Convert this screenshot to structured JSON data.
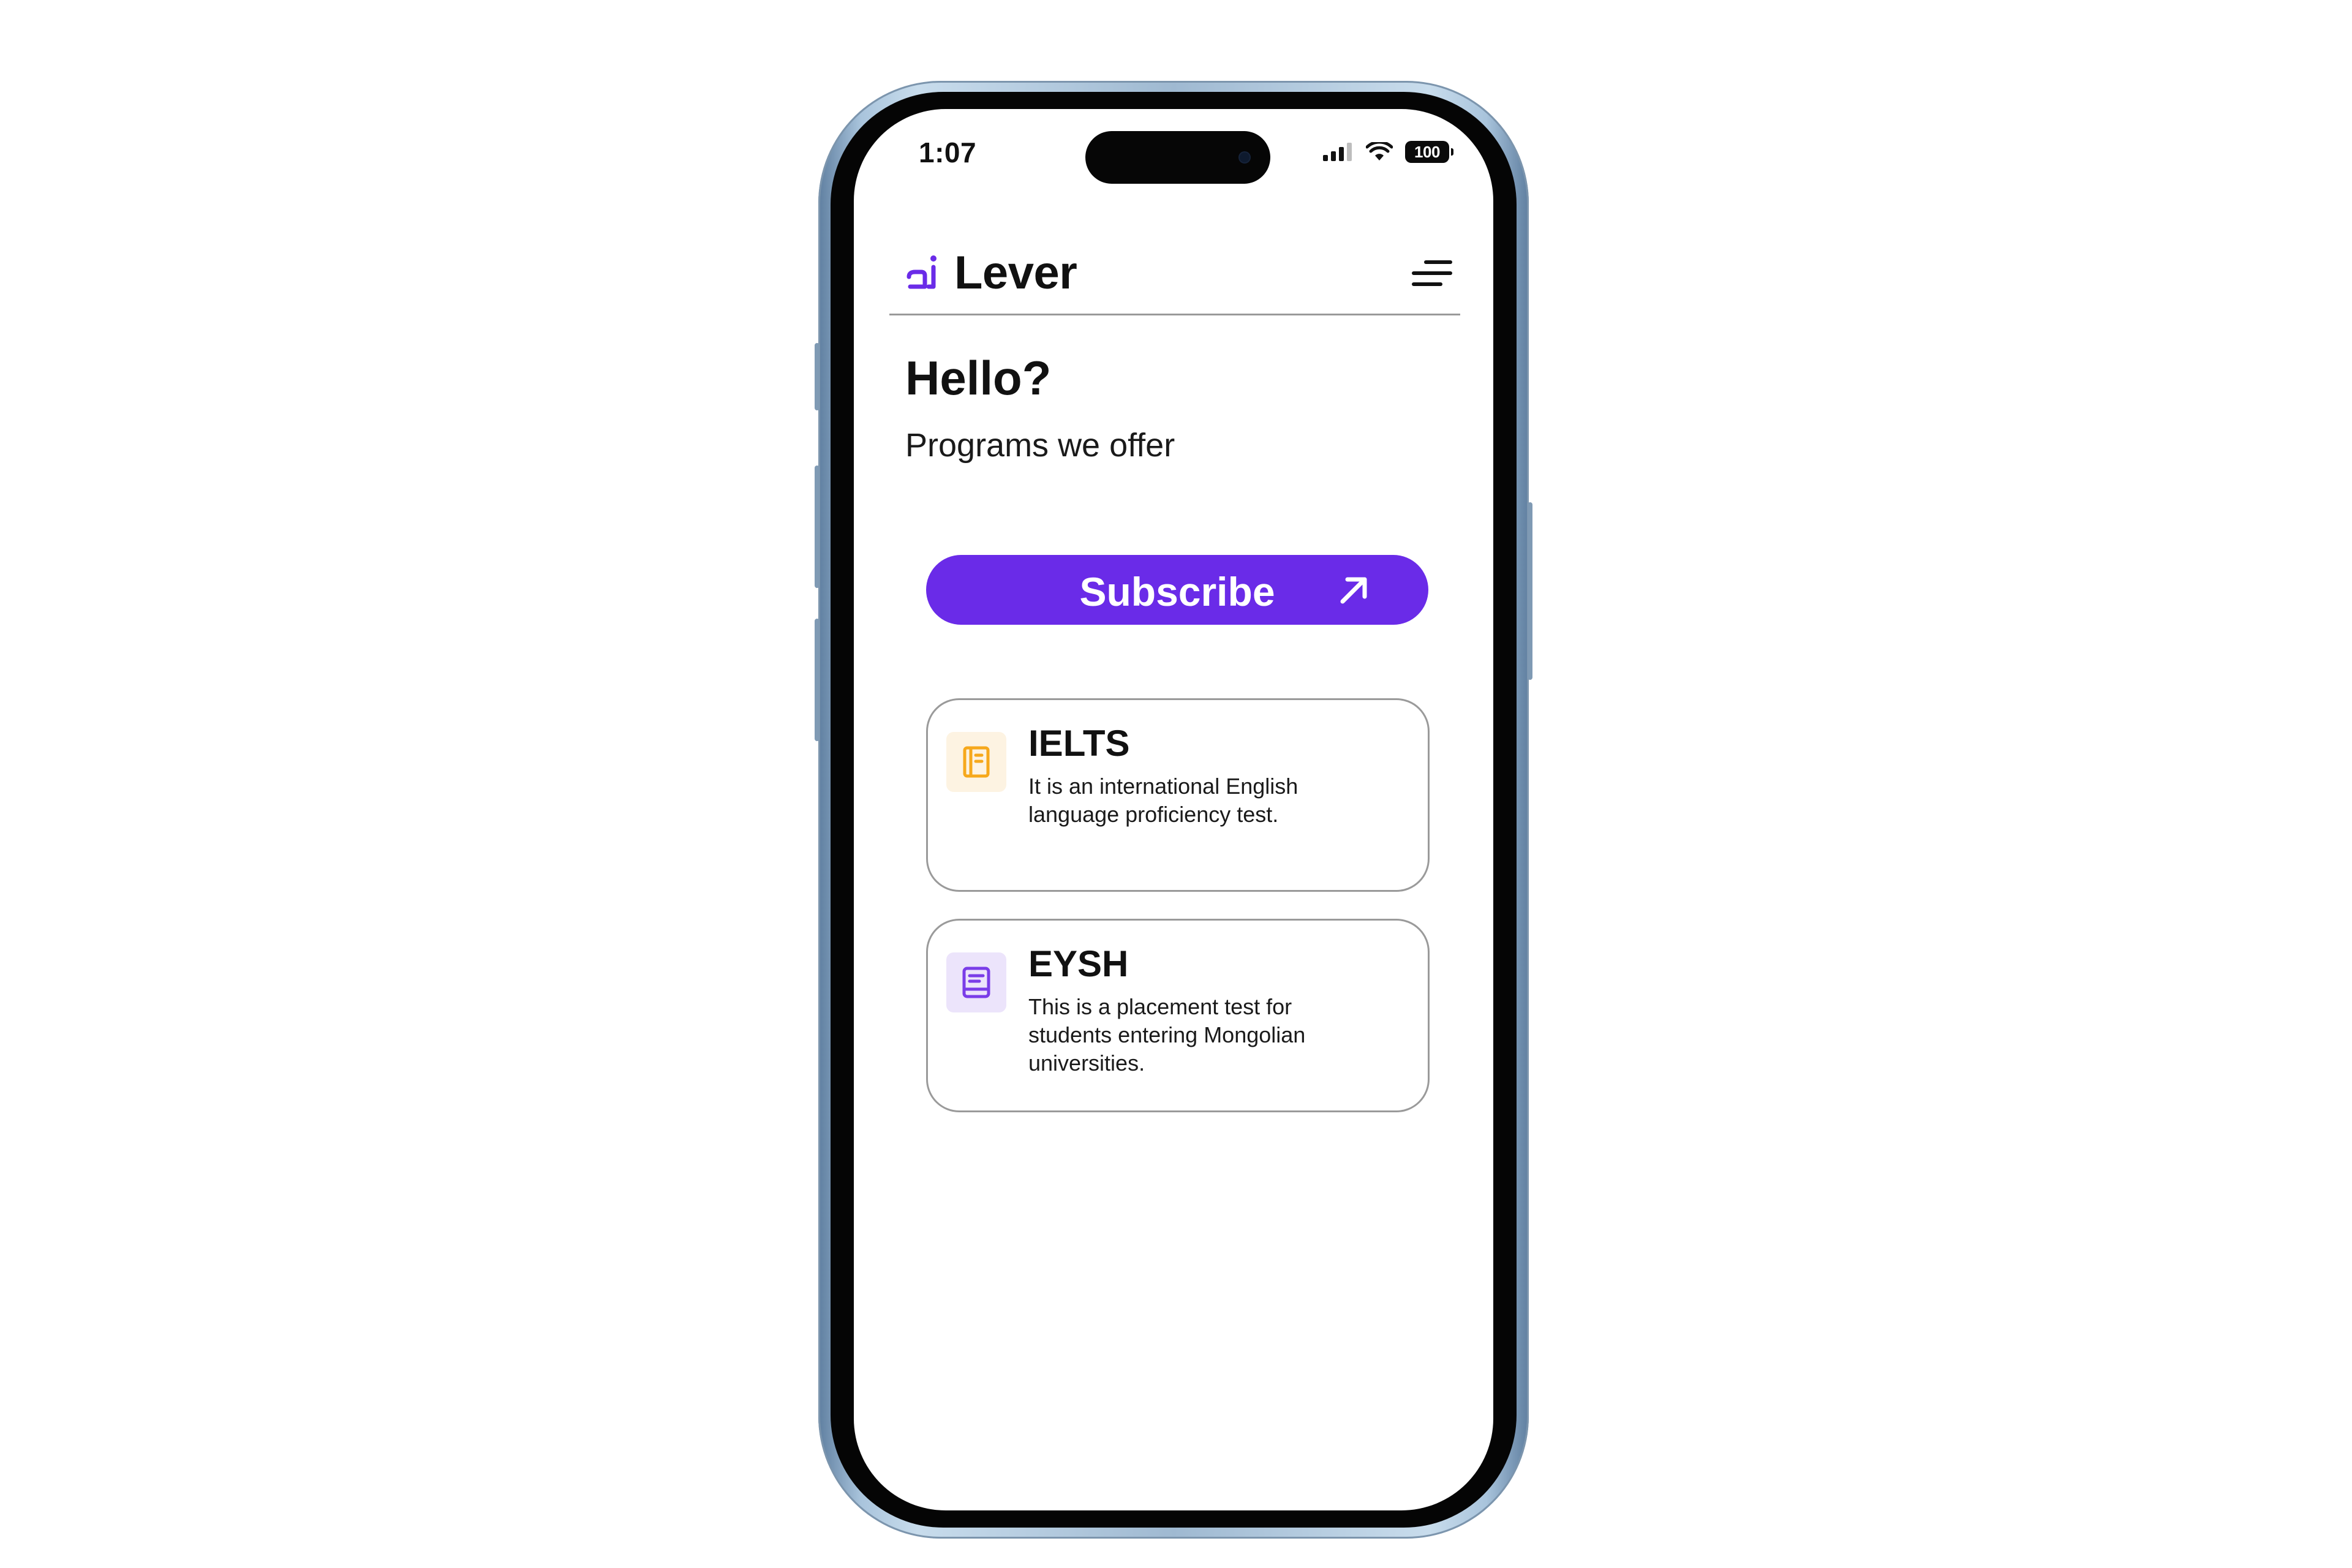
{
  "status_bar": {
    "time": "1:07",
    "battery": "100",
    "icons": [
      "cellular-signal-icon",
      "wifi-icon",
      "battery-icon"
    ]
  },
  "header": {
    "logo_text": "Lever",
    "logo_icon": "lever-logo-icon",
    "menu_icon": "hamburger-menu-icon"
  },
  "greeting": "Hello?",
  "subtitle": "Programs we offer",
  "subscribe": {
    "label": "Subscribe",
    "icon": "arrow-up-right-icon"
  },
  "programs": [
    {
      "title": "IELTS",
      "description": "It is an international English language proficiency test.",
      "icon": "notebook-icon"
    },
    {
      "title": "EYSH",
      "description": "This is a placement test for students entering Mongolian universities.",
      "icon": "book-icon"
    }
  ],
  "colors": {
    "accent": "#6a2be8",
    "ielts_icon": "#f6a81c",
    "ielts_icon_bg": "#fdf3e2",
    "eysh_icon": "#7a3de8",
    "eysh_icon_bg": "#ece4fb",
    "phone_frame": "#a9c4dc"
  }
}
